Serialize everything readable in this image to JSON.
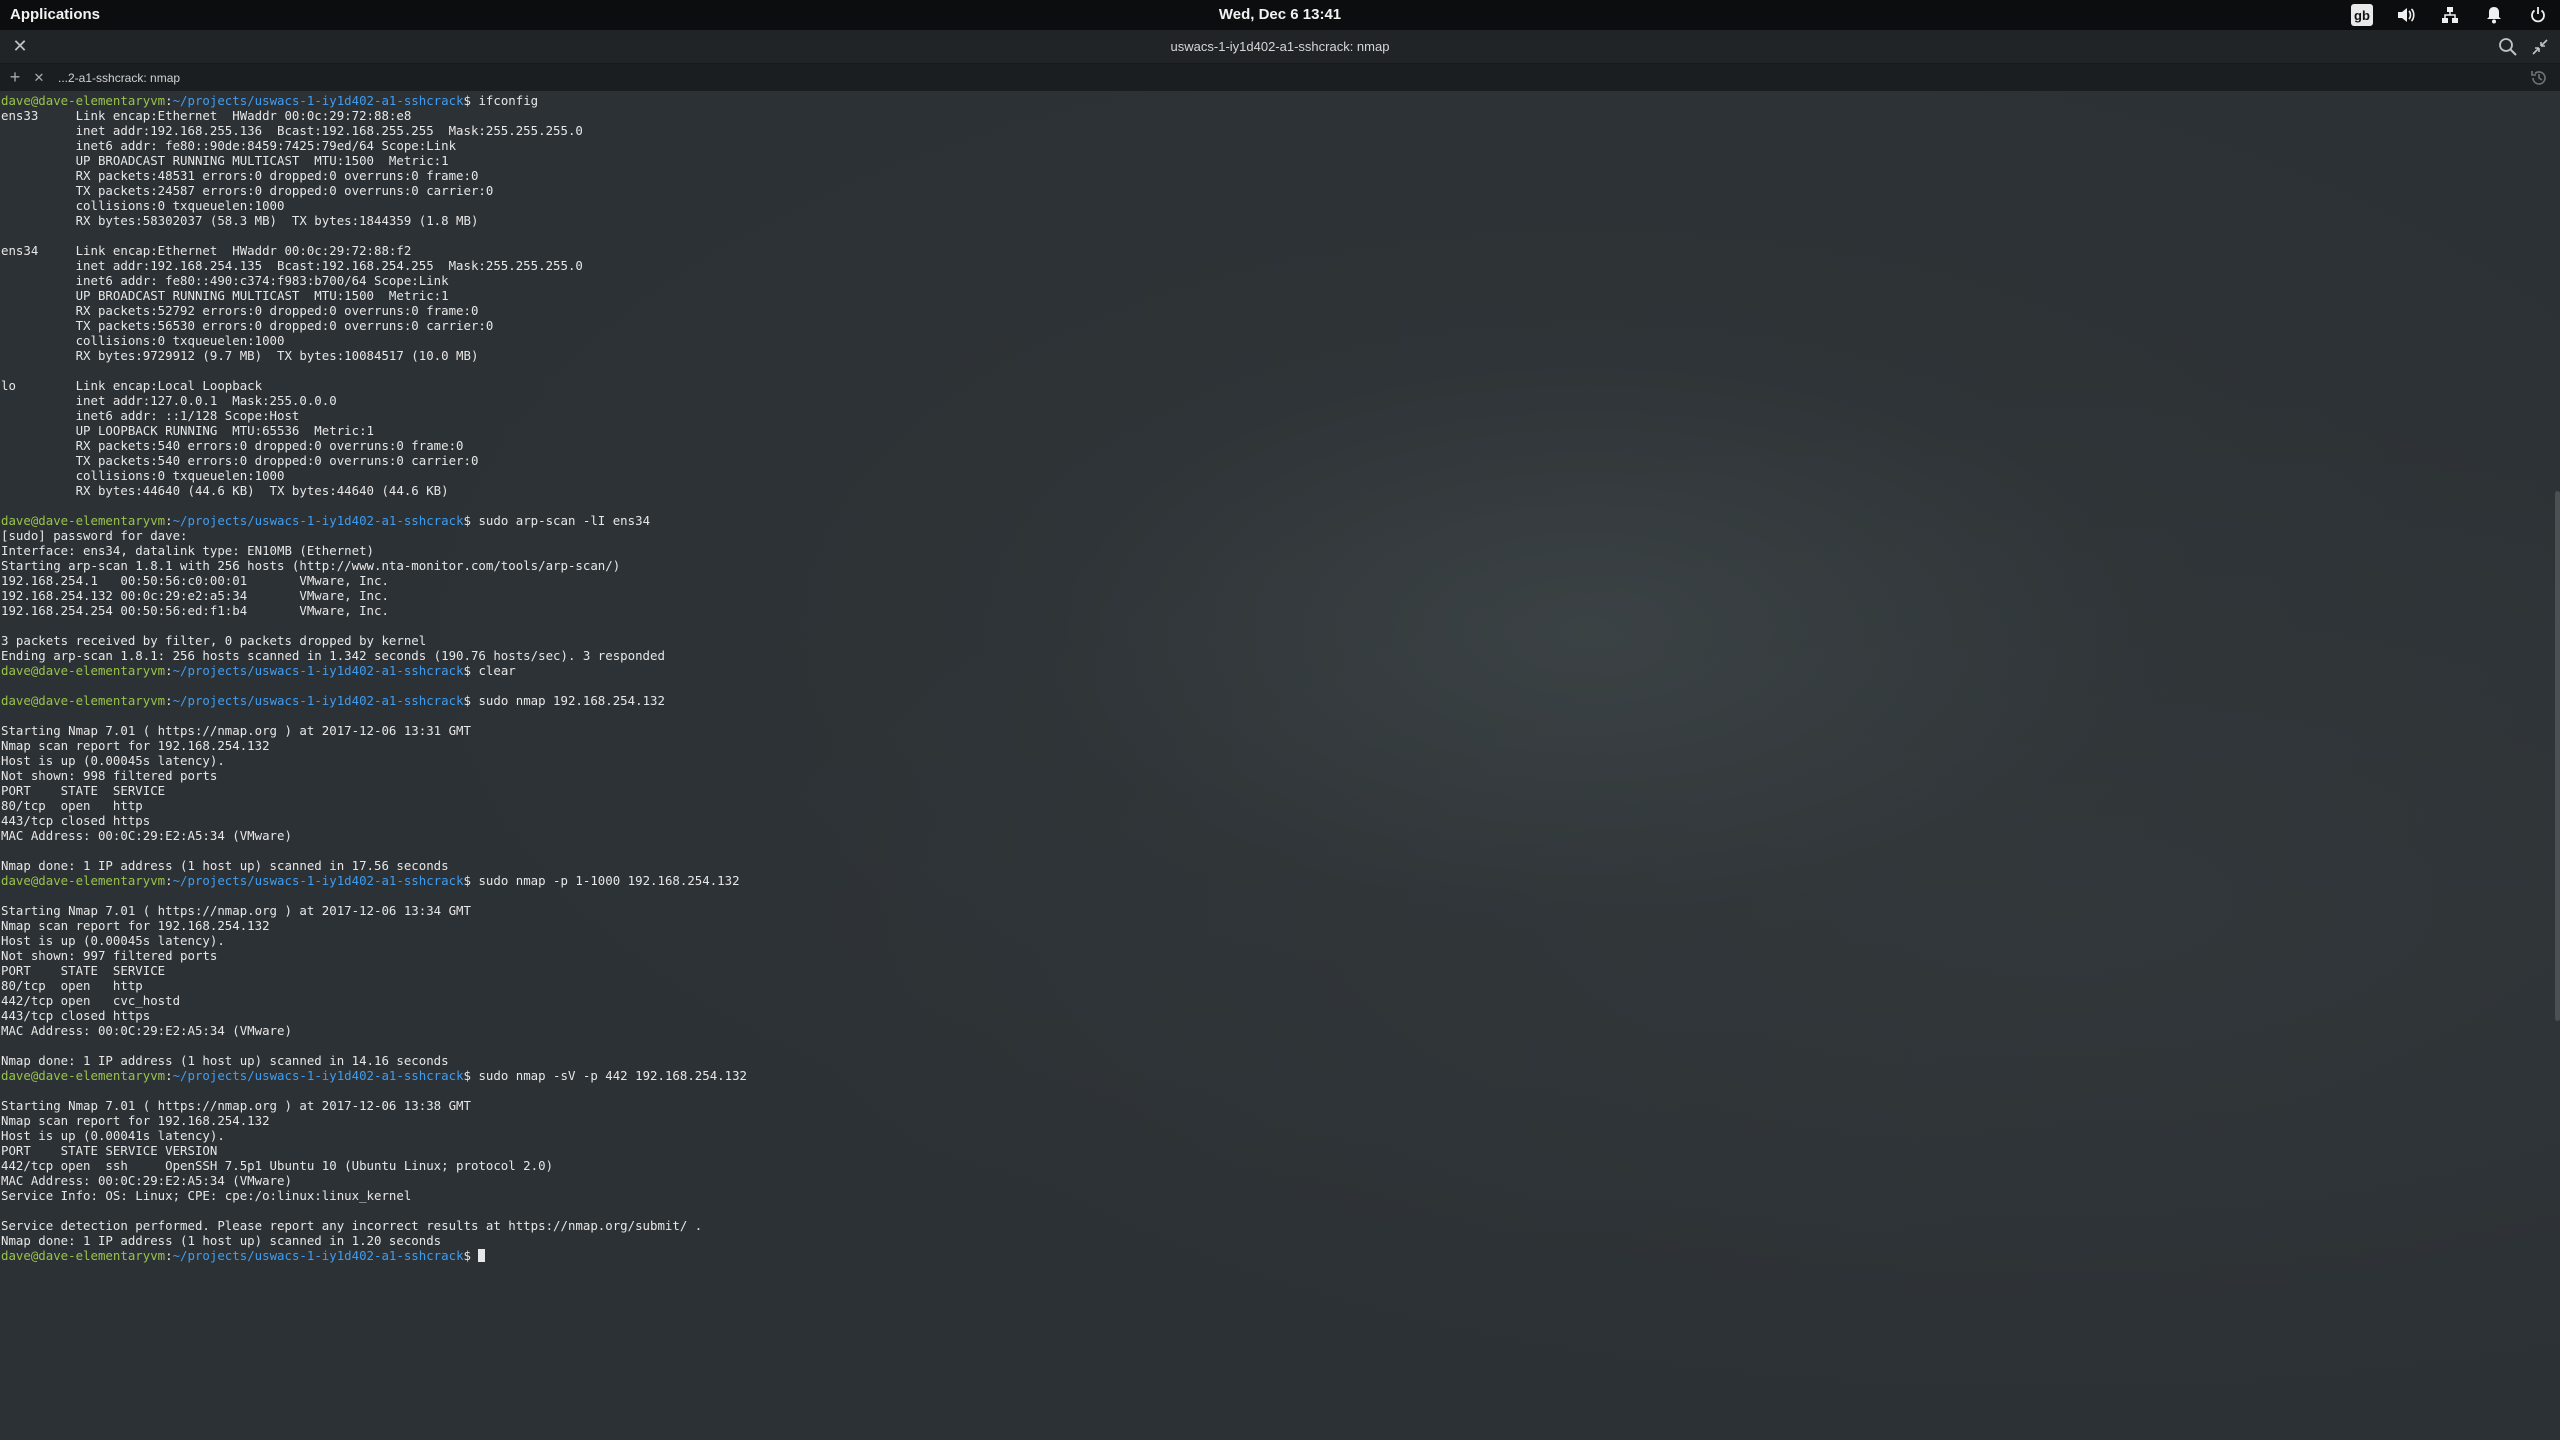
{
  "topbar": {
    "applications_label": "Applications",
    "clock": "Wed, Dec 6   13:41",
    "keyboard_layout": "gb"
  },
  "window": {
    "title": "uswacs-1-iy1d402-a1-sshcrack: nmap"
  },
  "tabs": [
    {
      "label": "...2-a1-sshcrack: nmap"
    }
  ],
  "terminal": {
    "user_host": "dave@dave-elementaryvm",
    "path": "~/projects/uswacs-1-iy1d402-a1-sshcrack",
    "lines": [
      {
        "prompt": true,
        "cmd": "ifconfig"
      },
      {
        "text": "ens33     Link encap:Ethernet  HWaddr 00:0c:29:72:88:e8"
      },
      {
        "text": "          inet addr:192.168.255.136  Bcast:192.168.255.255  Mask:255.255.255.0"
      },
      {
        "text": "          inet6 addr: fe80::90de:8459:7425:79ed/64 Scope:Link"
      },
      {
        "text": "          UP BROADCAST RUNNING MULTICAST  MTU:1500  Metric:1"
      },
      {
        "text": "          RX packets:48531 errors:0 dropped:0 overruns:0 frame:0"
      },
      {
        "text": "          TX packets:24587 errors:0 dropped:0 overruns:0 carrier:0"
      },
      {
        "text": "          collisions:0 txqueuelen:1000"
      },
      {
        "text": "          RX bytes:58302037 (58.3 MB)  TX bytes:1844359 (1.8 MB)"
      },
      {
        "text": ""
      },
      {
        "text": "ens34     Link encap:Ethernet  HWaddr 00:0c:29:72:88:f2"
      },
      {
        "text": "          inet addr:192.168.254.135  Bcast:192.168.254.255  Mask:255.255.255.0"
      },
      {
        "text": "          inet6 addr: fe80::490:c374:f983:b700/64 Scope:Link"
      },
      {
        "text": "          UP BROADCAST RUNNING MULTICAST  MTU:1500  Metric:1"
      },
      {
        "text": "          RX packets:52792 errors:0 dropped:0 overruns:0 frame:0"
      },
      {
        "text": "          TX packets:56530 errors:0 dropped:0 overruns:0 carrier:0"
      },
      {
        "text": "          collisions:0 txqueuelen:1000"
      },
      {
        "text": "          RX bytes:9729912 (9.7 MB)  TX bytes:10084517 (10.0 MB)"
      },
      {
        "text": ""
      },
      {
        "text": "lo        Link encap:Local Loopback"
      },
      {
        "text": "          inet addr:127.0.0.1  Mask:255.0.0.0"
      },
      {
        "text": "          inet6 addr: ::1/128 Scope:Host"
      },
      {
        "text": "          UP LOOPBACK RUNNING  MTU:65536  Metric:1"
      },
      {
        "text": "          RX packets:540 errors:0 dropped:0 overruns:0 frame:0"
      },
      {
        "text": "          TX packets:540 errors:0 dropped:0 overruns:0 carrier:0"
      },
      {
        "text": "          collisions:0 txqueuelen:1000"
      },
      {
        "text": "          RX bytes:44640 (44.6 KB)  TX bytes:44640 (44.6 KB)"
      },
      {
        "text": ""
      },
      {
        "prompt": true,
        "cmd": "sudo arp-scan -lI ens34"
      },
      {
        "text": "[sudo] password for dave:"
      },
      {
        "text": "Interface: ens34, datalink type: EN10MB (Ethernet)"
      },
      {
        "text": "Starting arp-scan 1.8.1 with 256 hosts (http://www.nta-monitor.com/tools/arp-scan/)"
      },
      {
        "text": "192.168.254.1   00:50:56:c0:00:01       VMware, Inc."
      },
      {
        "text": "192.168.254.132 00:0c:29:e2:a5:34       VMware, Inc."
      },
      {
        "text": "192.168.254.254 00:50:56:ed:f1:b4       VMware, Inc."
      },
      {
        "text": ""
      },
      {
        "text": "3 packets received by filter, 0 packets dropped by kernel"
      },
      {
        "text": "Ending arp-scan 1.8.1: 256 hosts scanned in 1.342 seconds (190.76 hosts/sec). 3 responded"
      },
      {
        "prompt": true,
        "cmd": "clear"
      },
      {
        "text": ""
      },
      {
        "prompt": true,
        "cmd": "sudo nmap 192.168.254.132"
      },
      {
        "text": ""
      },
      {
        "text": "Starting Nmap 7.01 ( https://nmap.org ) at 2017-12-06 13:31 GMT"
      },
      {
        "text": "Nmap scan report for 192.168.254.132"
      },
      {
        "text": "Host is up (0.00045s latency)."
      },
      {
        "text": "Not shown: 998 filtered ports"
      },
      {
        "text": "PORT    STATE  SERVICE"
      },
      {
        "text": "80/tcp  open   http"
      },
      {
        "text": "443/tcp closed https"
      },
      {
        "text": "MAC Address: 00:0C:29:E2:A5:34 (VMware)"
      },
      {
        "text": ""
      },
      {
        "text": "Nmap done: 1 IP address (1 host up) scanned in 17.56 seconds"
      },
      {
        "prompt": true,
        "cmd": "sudo nmap -p 1-1000 192.168.254.132"
      },
      {
        "text": ""
      },
      {
        "text": "Starting Nmap 7.01 ( https://nmap.org ) at 2017-12-06 13:34 GMT"
      },
      {
        "text": "Nmap scan report for 192.168.254.132"
      },
      {
        "text": "Host is up (0.00045s latency)."
      },
      {
        "text": "Not shown: 997 filtered ports"
      },
      {
        "text": "PORT    STATE  SERVICE"
      },
      {
        "text": "80/tcp  open   http"
      },
      {
        "text": "442/tcp open   cvc_hostd"
      },
      {
        "text": "443/tcp closed https"
      },
      {
        "text": "MAC Address: 00:0C:29:E2:A5:34 (VMware)"
      },
      {
        "text": ""
      },
      {
        "text": "Nmap done: 1 IP address (1 host up) scanned in 14.16 seconds"
      },
      {
        "prompt": true,
        "cmd": "sudo nmap -sV -p 442 192.168.254.132"
      },
      {
        "text": ""
      },
      {
        "text": "Starting Nmap 7.01 ( https://nmap.org ) at 2017-12-06 13:38 GMT"
      },
      {
        "text": "Nmap scan report for 192.168.254.132"
      },
      {
        "text": "Host is up (0.00041s latency)."
      },
      {
        "text": "PORT    STATE SERVICE VERSION"
      },
      {
        "text": "442/tcp open  ssh     OpenSSH 7.5p1 Ubuntu 10 (Ubuntu Linux; protocol 2.0)"
      },
      {
        "text": "MAC Address: 00:0C:29:E2:A5:34 (VMware)"
      },
      {
        "text": "Service Info: OS: Linux; CPE: cpe:/o:linux:linux_kernel"
      },
      {
        "text": ""
      },
      {
        "text": "Service detection performed. Please report any incorrect results at https://nmap.org/submit/ ."
      },
      {
        "text": "Nmap done: 1 IP address (1 host up) scanned in 1.20 seconds"
      },
      {
        "prompt": true,
        "cmd": "",
        "cursor": true
      }
    ]
  }
}
